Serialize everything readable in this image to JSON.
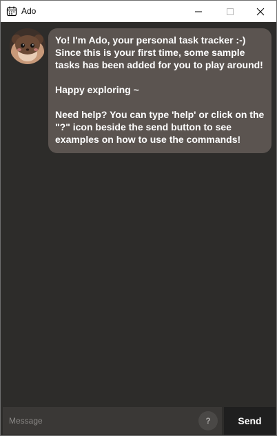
{
  "window": {
    "title": "Ado"
  },
  "chat": {
    "messages": [
      {
        "sender": "bot",
        "avatar_icon": "hamster-avatar",
        "text": "Yo! I'm Ado, your personal task tracker :-)\nSince this is your first time, some sample tasks has been added for you to play around!\n\nHappy exploring ~\n\nNeed help? You can type 'help' or click on the \"?\" icon beside the send button to see examples on how to use the commands!"
      }
    ]
  },
  "input": {
    "placeholder": "Message",
    "value": "",
    "help_label": "?",
    "send_label": "Send"
  },
  "colors": {
    "background": "#2d2c2a",
    "bubble": "#5b5450",
    "send_button": "#1f1f1f",
    "input": "#3a3836"
  }
}
